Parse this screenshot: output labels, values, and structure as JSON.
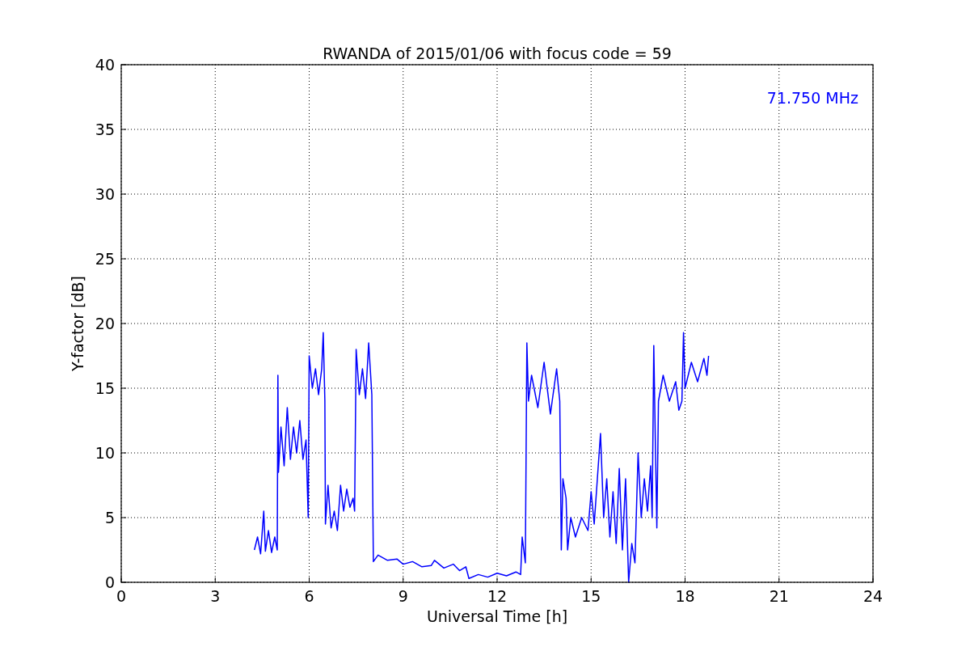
{
  "chart_data": {
    "type": "line",
    "title": "RWANDA of 2015/01/06 with focus code = 59",
    "xlabel": "Universal Time [h]",
    "ylabel": "Y-factor [dB]",
    "x": [
      4.25,
      4.35,
      4.45,
      4.55,
      4.6,
      4.7,
      4.8,
      4.9,
      4.98,
      5.0,
      5.02,
      5.1,
      5.2,
      5.3,
      5.4,
      5.5,
      5.6,
      5.7,
      5.8,
      5.9,
      5.97,
      6.0,
      6.1,
      6.2,
      6.3,
      6.4,
      6.45,
      6.5,
      6.52,
      6.6,
      6.7,
      6.8,
      6.9,
      7.0,
      7.1,
      7.2,
      7.3,
      7.4,
      7.45,
      7.5,
      7.6,
      7.7,
      7.8,
      7.9,
      8.0,
      8.05,
      8.2,
      8.5,
      8.8,
      9.0,
      9.3,
      9.6,
      9.9,
      10.0,
      10.3,
      10.6,
      10.8,
      11.0,
      11.1,
      11.4,
      11.7,
      12.0,
      12.3,
      12.6,
      12.75,
      12.8,
      12.9,
      12.95,
      13.0,
      13.1,
      13.3,
      13.5,
      13.7,
      13.9,
      14.0,
      14.05,
      14.1,
      14.2,
      14.25,
      14.35,
      14.5,
      14.7,
      14.9,
      15.0,
      15.1,
      15.2,
      15.3,
      15.4,
      15.5,
      15.6,
      15.7,
      15.8,
      15.9,
      16.0,
      16.1,
      16.2,
      16.3,
      16.4,
      16.5,
      16.6,
      16.7,
      16.8,
      16.9,
      16.95,
      17.0,
      17.05,
      17.1,
      17.15,
      17.3,
      17.5,
      17.7,
      17.8,
      17.9,
      17.95,
      18.0,
      18.2,
      18.4,
      18.6,
      18.7,
      18.75
    ],
    "series": [
      {
        "color": "#0000ff",
        "values": [
          2.5,
          3.5,
          2.2,
          5.5,
          2.4,
          4.0,
          2.3,
          3.5,
          2.5,
          16,
          8.5,
          12,
          9,
          13.5,
          9.5,
          12,
          10,
          12.5,
          9.5,
          11,
          5,
          17.5,
          15,
          16.5,
          14.5,
          16.5,
          19.3,
          14,
          4.5,
          7.5,
          4.2,
          5.5,
          4,
          7.5,
          5.5,
          7.2,
          5.8,
          6.5,
          5.5,
          18,
          14.5,
          16.5,
          14.2,
          18.5,
          14.5,
          1.6,
          2.1,
          1.7,
          1.8,
          1.4,
          1.6,
          1.2,
          1.3,
          1.7,
          1.1,
          1.4,
          0.9,
          1.2,
          0.3,
          0.6,
          0.4,
          0.7,
          0.5,
          0.8,
          0.6,
          3.5,
          1.5,
          18.5,
          14,
          16,
          13.5,
          17,
          13,
          16.5,
          14,
          2.5,
          8,
          6.5,
          2.5,
          5,
          3.5,
          5,
          4,
          7,
          4.5,
          8,
          11.5,
          5,
          8,
          3.5,
          7,
          3,
          8.8,
          2.5,
          8,
          0,
          3,
          1.5,
          10,
          5,
          8,
          5.5,
          9,
          5,
          18.3,
          11,
          4.2,
          14,
          16,
          14,
          15.5,
          13.3,
          14,
          19.3,
          15,
          17,
          15.5,
          17.3,
          16,
          17.5
        ]
      }
    ],
    "xlim": [
      0,
      24
    ],
    "ylim": [
      0,
      40
    ],
    "xticks": [
      0,
      3,
      6,
      9,
      12,
      15,
      18,
      21,
      24
    ],
    "yticks": [
      0,
      5,
      10,
      15,
      20,
      25,
      30,
      35,
      40
    ],
    "grid": true,
    "annotations": [
      "71.750 MHz"
    ]
  }
}
